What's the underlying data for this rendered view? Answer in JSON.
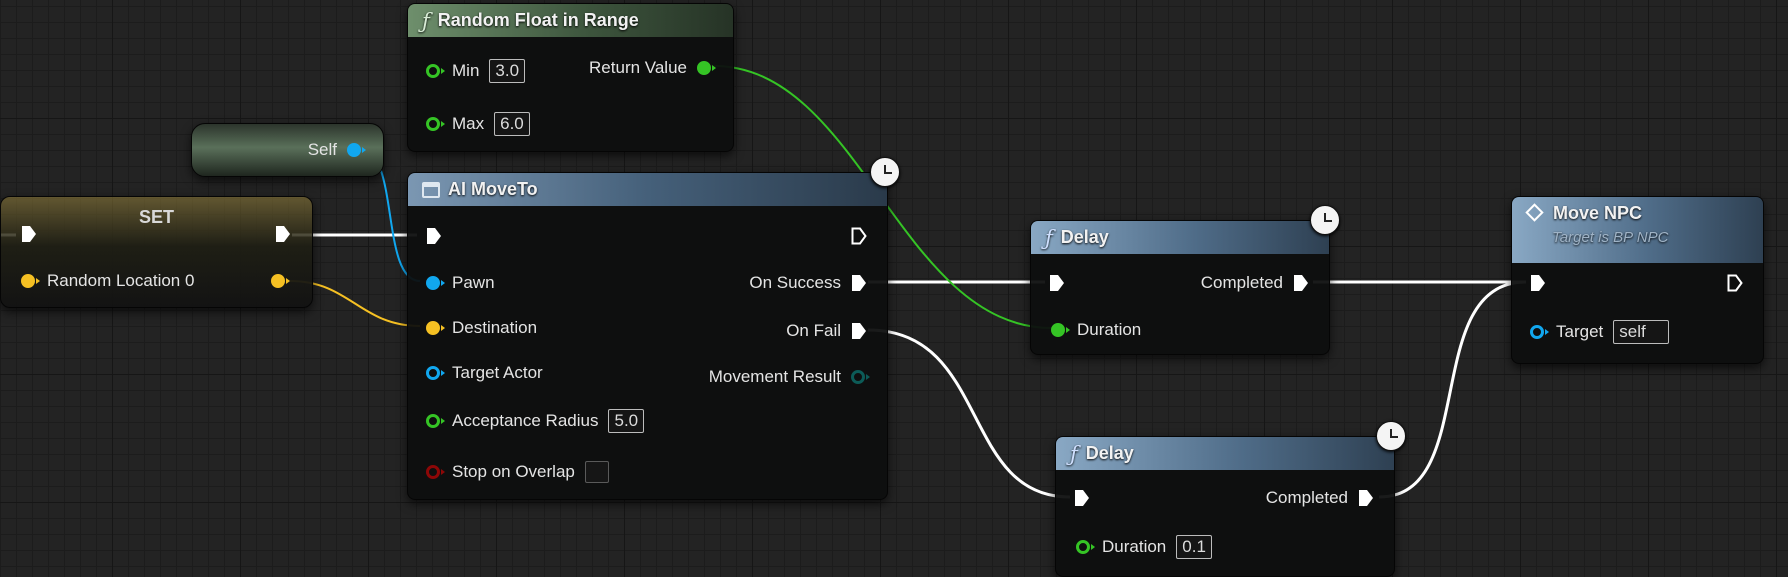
{
  "nodes": {
    "random_float": {
      "title": "Random Float in Range",
      "min_label": "Min",
      "min_value": "3.0",
      "max_label": "Max",
      "max_value": "6.0",
      "return_label": "Return Value"
    },
    "self_node": {
      "label": "Self"
    },
    "set_node": {
      "title": "SET",
      "var_label": "Random Location 0"
    },
    "ai_moveto": {
      "title": "AI MoveTo",
      "pawn": "Pawn",
      "destination": "Destination",
      "target_actor": "Target Actor",
      "acceptance_radius": "Acceptance Radius",
      "acceptance_radius_value": "5.0",
      "stop_on_overlap": "Stop on Overlap",
      "on_success": "On Success",
      "on_fail": "On Fail",
      "movement_result": "Movement Result"
    },
    "delay_1": {
      "title": "Delay",
      "completed": "Completed",
      "duration": "Duration"
    },
    "delay_2": {
      "title": "Delay",
      "completed": "Completed",
      "duration": "Duration",
      "duration_value": "0.1"
    },
    "move_npc": {
      "title": "Move NPC",
      "subtitle": "Target is BP NPC",
      "target": "Target",
      "target_value": "self"
    }
  },
  "colors": {
    "exec": "#ffffff",
    "float": "#35c425",
    "vector": "#f5c023",
    "object": "#11a7ef",
    "bool": "#8d0707",
    "enum": "#0c5b57"
  },
  "icons": {
    "function": "function-f-icon",
    "latent": "clock-icon",
    "macro": "window-icon",
    "event": "diamond-icon"
  }
}
